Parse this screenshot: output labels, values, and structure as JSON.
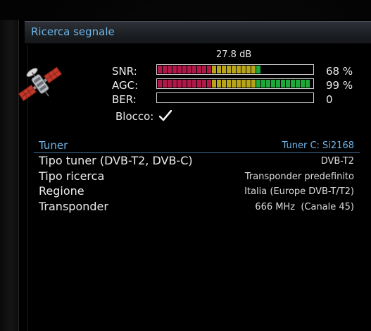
{
  "window": {
    "title": "Ricerca segnale"
  },
  "signal": {
    "db_readout": "27.8 dB",
    "meters": [
      {
        "label": "SNR:",
        "value_text": "68 %",
        "level": 0.68
      },
      {
        "label": "AGC:",
        "value_text": "99 %",
        "level": 0.99
      },
      {
        "label": "BER:",
        "value_text": "0",
        "level": 0
      }
    ],
    "lock_label": "Blocco:",
    "lock_icon": "checkmark-icon",
    "satellite_icon": "satellite-icon",
    "segment_colors": {
      "low": "#b0184a",
      "mid": "#b8a418",
      "high": "#1fa83a"
    }
  },
  "tuner": {
    "section_title": "Tuner",
    "tuner_id": "Tuner C: Si2168",
    "rows": [
      {
        "key": "Tipo tuner (DVB-T2, DVB-C)",
        "value": "DVB-T2"
      },
      {
        "key": "Tipo ricerca",
        "value": "Transponder predefinito"
      },
      {
        "key": "Regione",
        "value": "Italia (Europe DVB-T/T2)"
      },
      {
        "key": "Transponder",
        "value": "666 MHz  (Canale 45)"
      }
    ]
  },
  "colors": {
    "accent": "#6fb4e8",
    "background": "#000000",
    "text": "#ececec"
  }
}
